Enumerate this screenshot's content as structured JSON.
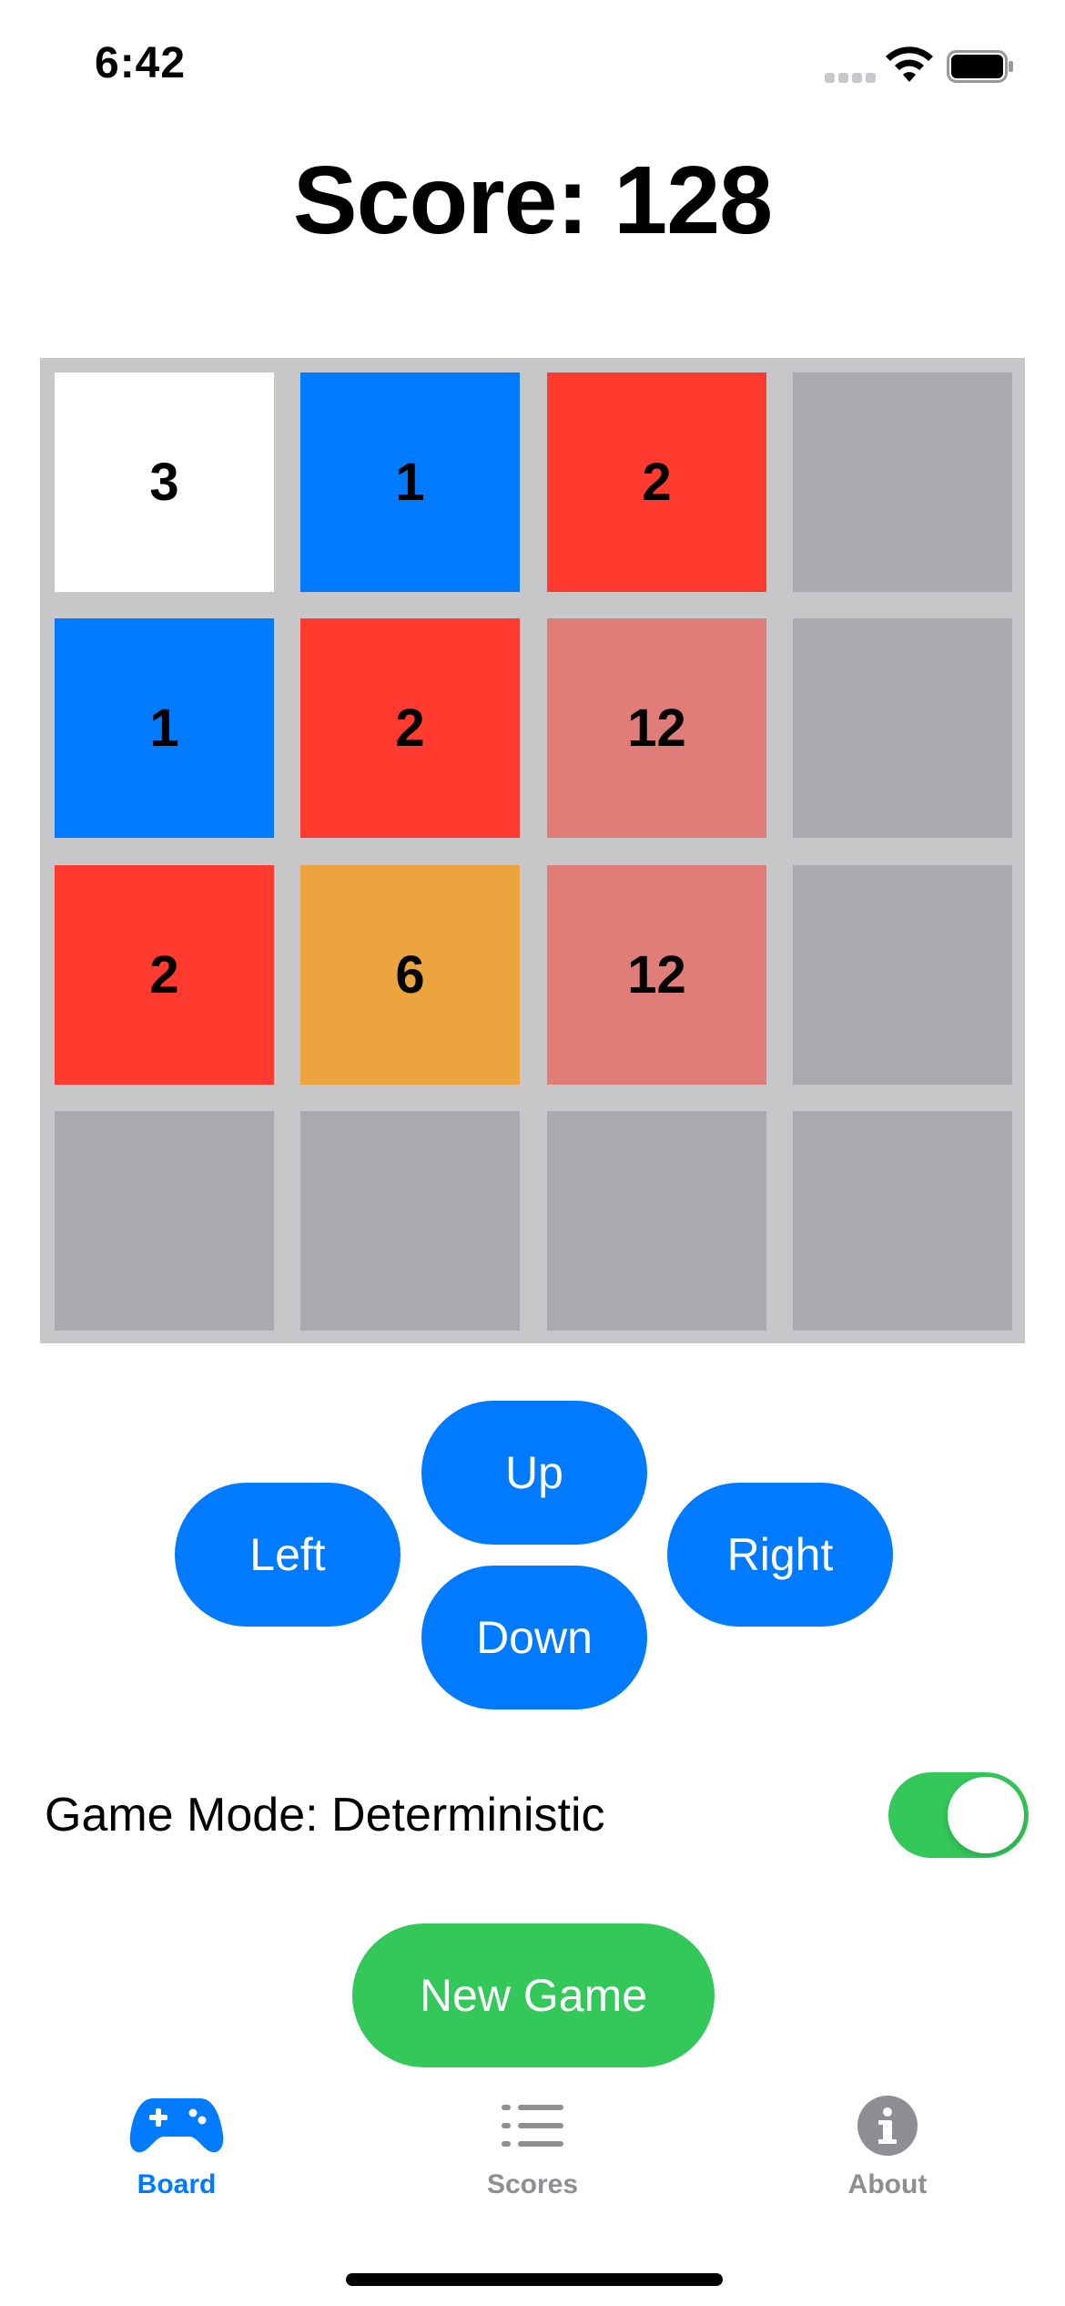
{
  "status_bar": {
    "time": "6:42"
  },
  "score_text": "Score: 128",
  "board": {
    "rows": [
      [
        {
          "value": "3",
          "color": "#ffffff"
        },
        {
          "value": "1",
          "color": "#007aff"
        },
        {
          "value": "2",
          "color": "#ff3b30"
        },
        {
          "value": "",
          "color": "#aaaaae"
        }
      ],
      [
        {
          "value": "1",
          "color": "#007aff"
        },
        {
          "value": "2",
          "color": "#ff3b30"
        },
        {
          "value": "12",
          "color": "#e17d79"
        },
        {
          "value": "",
          "color": "#aaaaae"
        }
      ],
      [
        {
          "value": "2",
          "color": "#ff3b30"
        },
        {
          "value": "6",
          "color": "#eba43e"
        },
        {
          "value": "12",
          "color": "#e17d79"
        },
        {
          "value": "",
          "color": "#aaaaae"
        }
      ],
      [
        {
          "value": "",
          "color": "#aaaaae"
        },
        {
          "value": "",
          "color": "#aaaaae"
        },
        {
          "value": "",
          "color": "#aaaaae"
        },
        {
          "value": "",
          "color": "#aaaaae"
        }
      ]
    ]
  },
  "controls": {
    "up": "Up",
    "left": "Left",
    "right": "Right",
    "down": "Down"
  },
  "game_mode": {
    "label": "Game Mode: Deterministic",
    "toggle_on": true
  },
  "new_game_label": "New Game",
  "tabs": [
    {
      "label": "Board",
      "icon": "gamecontroller-icon",
      "active": true
    },
    {
      "label": "Scores",
      "icon": "list-icon",
      "active": false
    },
    {
      "label": "About",
      "icon": "info-icon",
      "active": false
    }
  ],
  "colors": {
    "accent": "#007aff",
    "green": "#34c759",
    "inactive": "#8e8e93"
  }
}
